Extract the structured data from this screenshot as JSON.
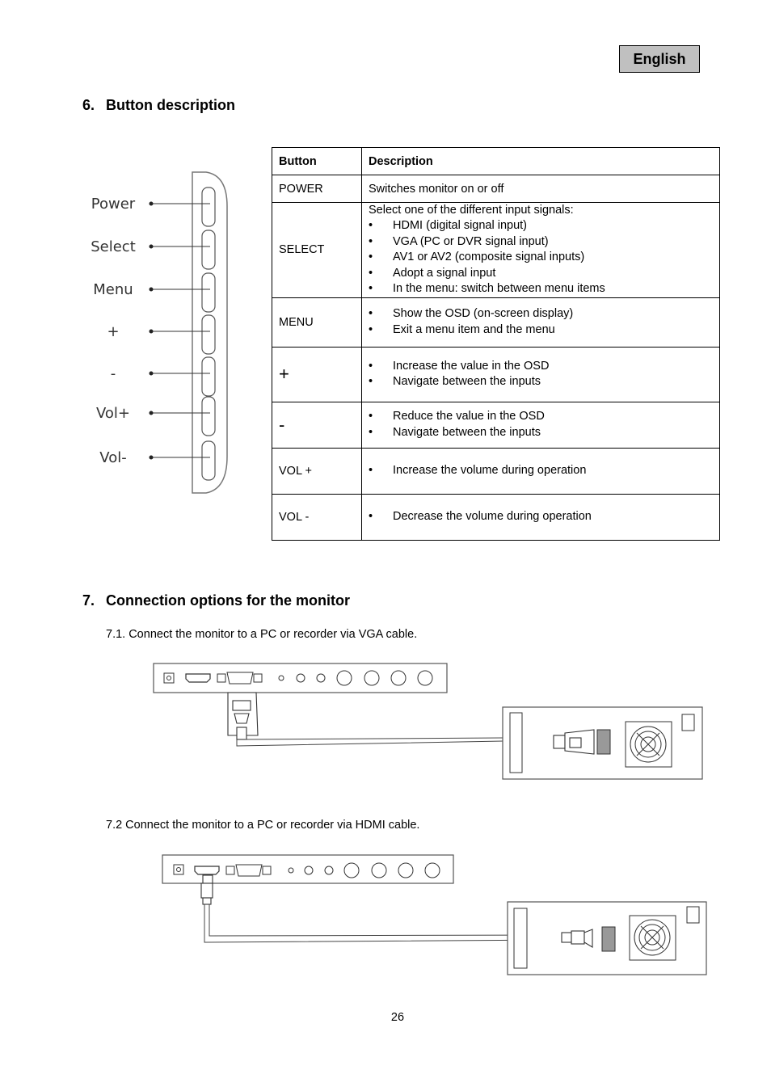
{
  "header": {
    "language_badge": "English"
  },
  "section6": {
    "number": "6.",
    "title": "Button description",
    "panel_labels": [
      "Power",
      "Select",
      "Menu",
      "+",
      "-",
      "Vol+",
      "Vol-"
    ],
    "table": {
      "headers": [
        "Button",
        "Description"
      ],
      "rows": [
        {
          "button": "POWER",
          "intro": "Switches monitor on or off",
          "bullets": []
        },
        {
          "button": "SELECT",
          "intro": "Select one of the different input signals:",
          "bullets": [
            "HDMI (digital signal input)",
            "VGA (PC or DVR signal input)",
            "AV1 or AV2 (composite signal inputs)",
            "Adopt a signal input",
            "In the menu: switch between menu items"
          ]
        },
        {
          "button": "MENU",
          "intro": "",
          "bullets": [
            "Show the OSD (on-screen display)",
            "Exit a menu item and the menu"
          ]
        },
        {
          "button": "+",
          "intro": "",
          "bullets": [
            "Increase the value in the OSD",
            "Navigate between the inputs"
          ]
        },
        {
          "button": "-",
          "intro": "",
          "bullets": [
            "Reduce the value in the OSD",
            "Navigate between the inputs"
          ]
        },
        {
          "button": "VOL +",
          "intro": "",
          "bullets": [
            "Increase the volume during operation"
          ]
        },
        {
          "button": "VOL -",
          "intro": "",
          "bullets": [
            "Decrease the volume during operation"
          ]
        }
      ]
    }
  },
  "section7": {
    "number": "7.",
    "title": "Connection options for the monitor",
    "sub1": "7.1. Connect the monitor to a PC or recorder via VGA cable.",
    "sub2": "7.2 Connect the monitor to a PC or recorder via HDMI cable."
  },
  "footer": {
    "page_number": "26"
  }
}
